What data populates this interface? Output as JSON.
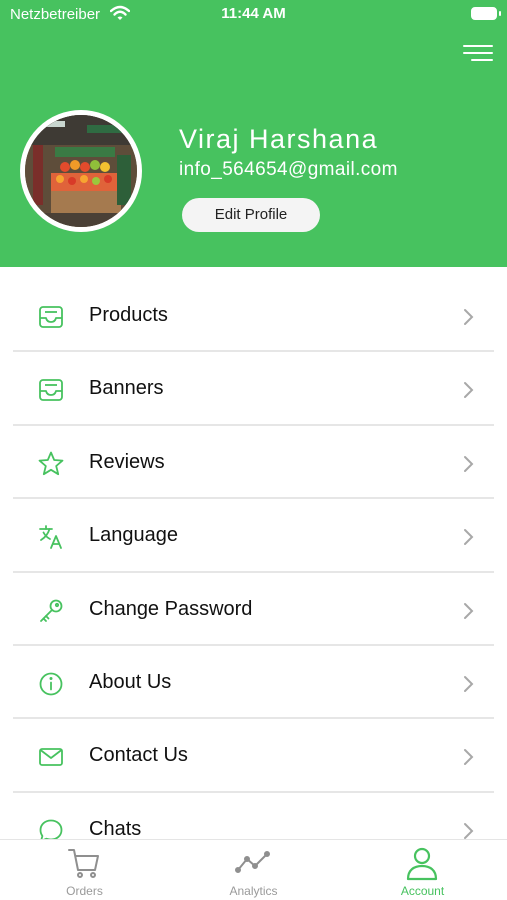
{
  "status_bar": {
    "carrier": "Netzbetreiber",
    "time": "11:44 AM"
  },
  "profile": {
    "name": "Viraj Harshana",
    "email": "info_564654@gmail.com",
    "edit_button": "Edit Profile"
  },
  "menu": [
    {
      "label": "Products",
      "icon": "inbox-tray-icon"
    },
    {
      "label": "Banners",
      "icon": "inbox-tray-icon"
    },
    {
      "label": "Reviews",
      "icon": "star-icon"
    },
    {
      "label": "Language",
      "icon": "translate-icon"
    },
    {
      "label": "Change Password",
      "icon": "key-icon"
    },
    {
      "label": "About Us",
      "icon": "info-icon"
    },
    {
      "label": "Contact Us",
      "icon": "mail-icon"
    },
    {
      "label": "Chats",
      "icon": "chat-bubble-icon"
    }
  ],
  "tabs": [
    {
      "label": "Orders",
      "icon": "cart-icon",
      "active": false
    },
    {
      "label": "Analytics",
      "icon": "analytics-icon",
      "active": false
    },
    {
      "label": "Account",
      "icon": "user-icon",
      "active": true
    }
  ],
  "colors": {
    "brand_green": "#47c25f",
    "inactive_gray": "#9a9a9a"
  }
}
